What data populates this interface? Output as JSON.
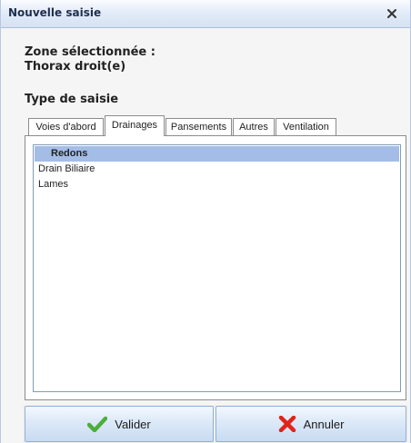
{
  "window": {
    "title": "Nouvelle saisie",
    "close_icon": "close-icon"
  },
  "zone": {
    "label": "Zone sélectionnée :",
    "value": "Thorax droit(e)"
  },
  "type_label": "Type de saisie",
  "tabs": [
    {
      "label": "Voies d'abord",
      "active": false
    },
    {
      "label": "Drainages",
      "active": true
    },
    {
      "label": "Pansements",
      "active": false
    },
    {
      "label": "Autres",
      "active": false
    },
    {
      "label": "Ventilation",
      "active": false
    }
  ],
  "list": {
    "items": [
      {
        "label": "Redons",
        "selected": true
      },
      {
        "label": "Drain Biliaire",
        "selected": false
      },
      {
        "label": "Lames",
        "selected": false
      }
    ]
  },
  "buttons": {
    "validate": {
      "label": "Valider",
      "icon": "check-icon",
      "icon_color": "#4caf3c"
    },
    "cancel": {
      "label": "Annuler",
      "icon": "x-icon",
      "icon_color": "#e0241b"
    }
  },
  "colors": {
    "selection": "#a4bde6",
    "title_text": "#1f2f4f",
    "button_border": "#8fb0d6"
  }
}
